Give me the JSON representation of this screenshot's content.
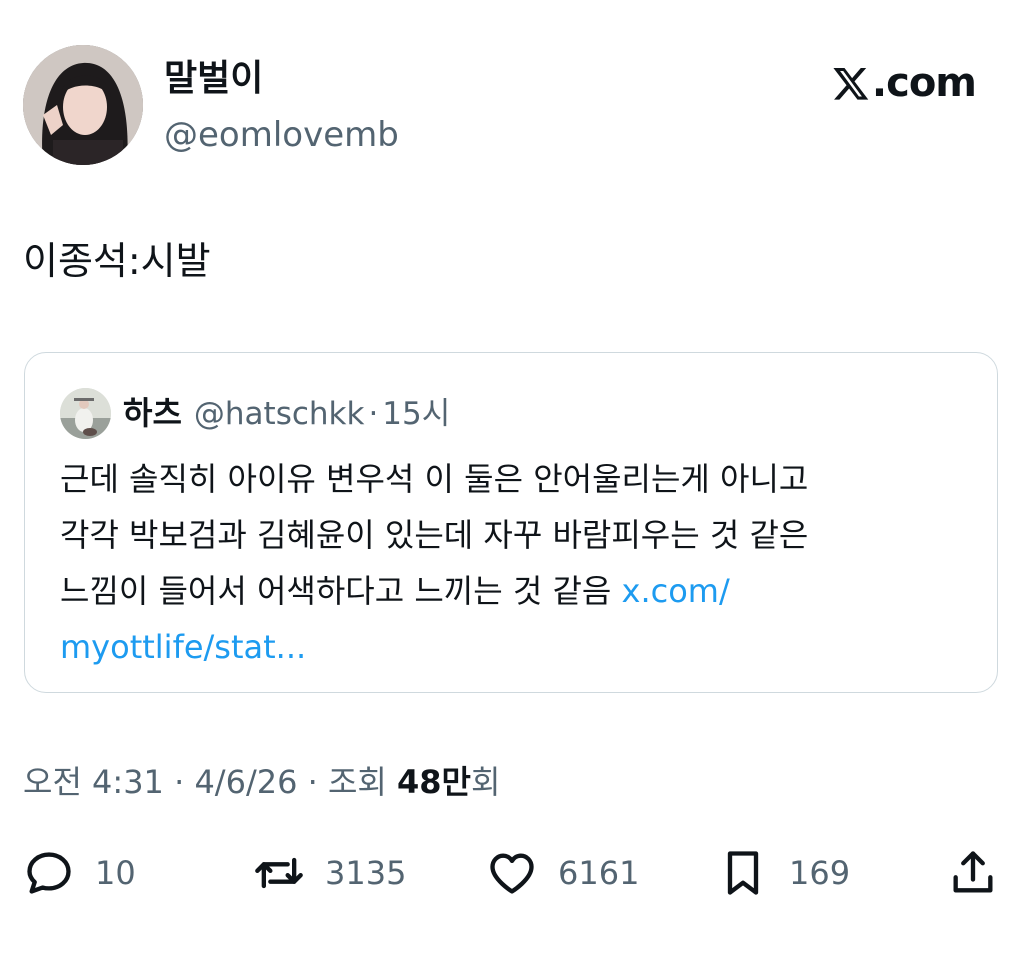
{
  "author": {
    "display_name": "말벌이",
    "handle": "@eomlovemb",
    "avatar": "profile-photo"
  },
  "brand": {
    "label": ".com",
    "logo": "x-logo"
  },
  "tweet": {
    "text": "이종석:시발"
  },
  "quoted": {
    "display_name": "하츠",
    "handle": "@hatschkk",
    "separator": "·",
    "time": "15시",
    "body_lines": [
      "근데 솔직히 아이유 변우석 이 둘은 안어울리는게 아니고",
      "각각 박보검과 김혜윤이 있는데 자꾸 바람피우는 것 같은",
      "느낌이 들어서 어색하다고 느끼는 것 같음 "
    ],
    "link_line1": "x.com/",
    "link_line2": "myottlife/stat..."
  },
  "meta": {
    "time": "오전 4:31",
    "sep1": " · ",
    "date": "4/6/26",
    "sep2": " · ",
    "views_label": "조회 ",
    "views_value": "48만",
    "views_suffix": "회"
  },
  "actions": {
    "reply": {
      "icon": "reply-icon",
      "count": "10"
    },
    "retweet": {
      "icon": "retweet-icon",
      "count": "3135"
    },
    "like": {
      "icon": "heart-icon",
      "count": "6161"
    },
    "bookmark": {
      "icon": "bookmark-icon",
      "count": "169"
    },
    "share": {
      "icon": "share-icon"
    }
  },
  "colors": {
    "text": "#0f1419",
    "secondary": "#536471",
    "link": "#1d9bf0",
    "border": "#cfd9de"
  }
}
